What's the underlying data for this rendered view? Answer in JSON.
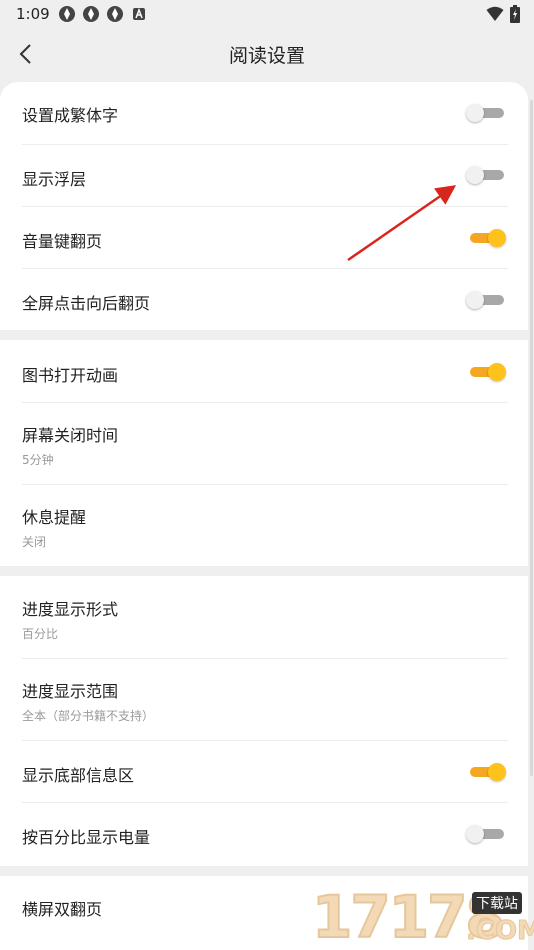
{
  "status_bar": {
    "time": "1:09",
    "notification_icons": [
      "app-notification-icon",
      "app-notification-icon",
      "app-notification-icon",
      "a-icon"
    ],
    "right_icons": [
      "wifi-icon",
      "battery-charging-icon"
    ]
  },
  "header": {
    "title": "阅读设置",
    "back_icon": "chevron-left-icon"
  },
  "groups": [
    {
      "rows": [
        {
          "title": "设置成繁体字",
          "toggle": false
        },
        {
          "title": "显示浮层",
          "toggle": false
        },
        {
          "title": "音量键翻页",
          "toggle": true
        },
        {
          "title": "全屏点击向后翻页",
          "toggle": false
        }
      ]
    },
    {
      "rows": [
        {
          "title": "图书打开动画",
          "toggle": true
        },
        {
          "title": "屏幕关闭时间",
          "subtitle": "5分钟"
        },
        {
          "title": "休息提醒",
          "subtitle": "关闭"
        }
      ]
    },
    {
      "rows": [
        {
          "title": "进度显示形式",
          "subtitle": "百分比"
        },
        {
          "title": "进度显示范围",
          "subtitle": "全本（部分书籍不支持）"
        },
        {
          "title": "显示底部信息区",
          "toggle": true
        },
        {
          "title": "按百分比显示电量",
          "toggle": false
        }
      ]
    },
    {
      "rows": [
        {
          "title": "横屏双翻页"
        }
      ]
    }
  ],
  "watermark": {
    "digits": "17178",
    "site_label": "下载站",
    "domain": ".COM"
  },
  "colors": {
    "toggle_on_track": "#f5a623",
    "toggle_on_knob": "#ffc21a",
    "toggle_off_track": "#a8a8a8",
    "annotation_arrow": "#d9261c"
  }
}
